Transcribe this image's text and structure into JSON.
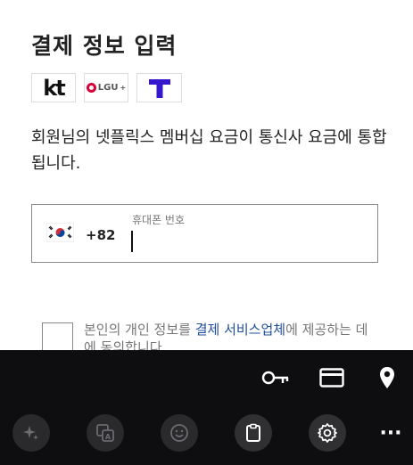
{
  "page": {
    "title": "결제 정보 입력",
    "description": "회원님의 넷플릭스 멤버십 요금이 통신사 요금에 통합됩니다."
  },
  "carriers": [
    {
      "name": "kt",
      "label": "kt"
    },
    {
      "name": "lgu",
      "label": "LGU"
    },
    {
      "name": "skt",
      "label": "T"
    }
  ],
  "phone": {
    "country_code": "+82",
    "placeholder": "휴대폰 번호",
    "value": ""
  },
  "consent": {
    "text_before": "본인의 개인 정보를 ",
    "link_text": "결제 서비스업체",
    "text_after": "에 제공하는 데에 동의합니다."
  },
  "keyboard": {
    "toolbar_top": [
      "key-icon",
      "card-icon",
      "location-pin-icon"
    ],
    "toolbar_bottom": [
      "sparkle-icon",
      "translate-icon",
      "emoji-icon",
      "clipboard-icon",
      "settings-icon",
      "more-icon"
    ],
    "more_label": "···"
  },
  "colors": {
    "text": "#222222",
    "link": "#1f4e9c",
    "keyboard_bg": "#0e0e10",
    "skt_blue": "#3617ce",
    "lgu_red": "#d6003a"
  }
}
